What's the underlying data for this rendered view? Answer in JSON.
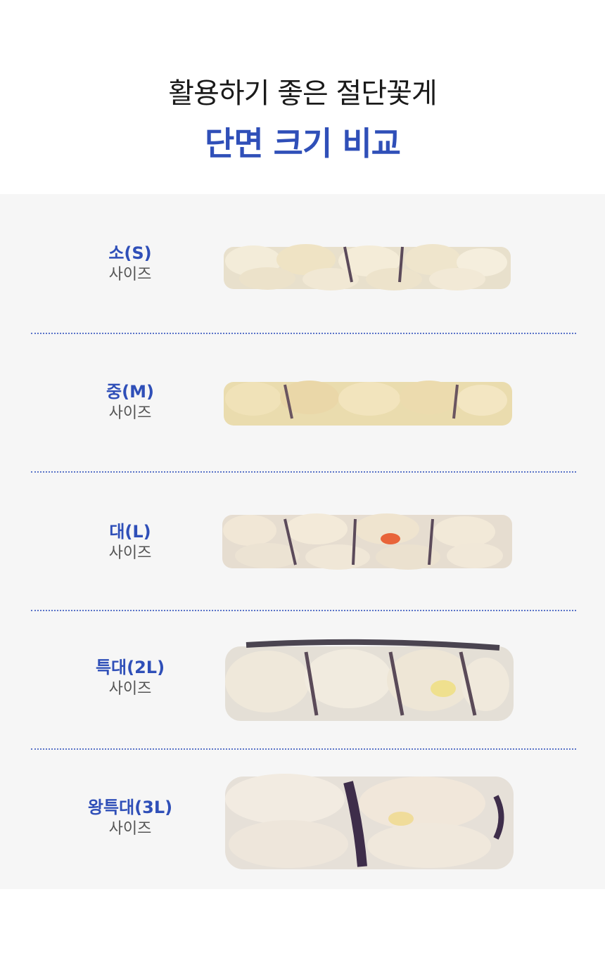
{
  "header": {
    "line1": "활용하기 좋은 절단꽃게",
    "line2": "단면 크기 비교"
  },
  "sizes": [
    {
      "name": "소(S)",
      "sub": "사이즈"
    },
    {
      "name": "중(M)",
      "sub": "사이즈"
    },
    {
      "name": "대(L)",
      "sub": "사이즈"
    },
    {
      "name": "특대(2L)",
      "sub": "사이즈"
    },
    {
      "name": "왕특대(3L)",
      "sub": "사이즈"
    }
  ],
  "colors": {
    "accent": "#2f4fb8",
    "panel": "#f6f6f6",
    "divider": "#5a74c8"
  }
}
